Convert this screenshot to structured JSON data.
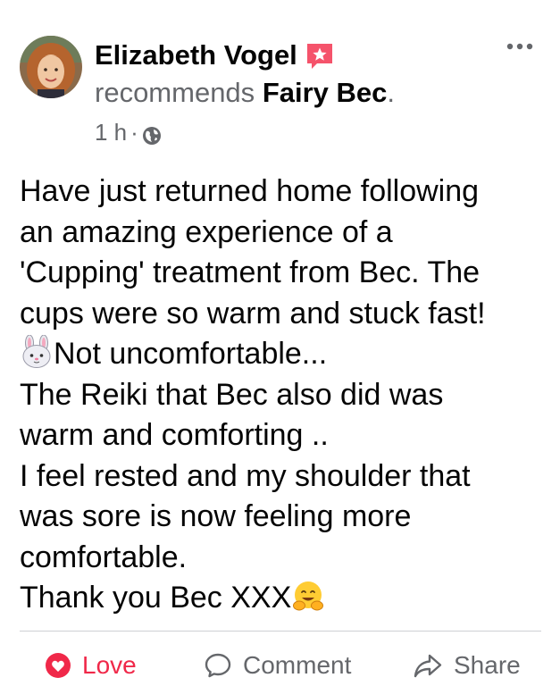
{
  "post": {
    "author_name": "Elizabeth Vogel",
    "recommend_verb": "recommends",
    "page_name": "Fairy Bec",
    "page_name_suffix": ".",
    "timestamp": "1 h",
    "meta_separator": "·",
    "audience_icon": "globe-icon",
    "body_lines": [
      "Have just returned home following",
      "an amazing experience of a",
      "'Cupping' treatment from Bec. The",
      "cups were so warm and stuck fast!",
      "Not uncomfortable...",
      "The Reiki that Bec also did was",
      "warm and comforting ..",
      "I feel rested and my shoulder that",
      "was sore is now feeling more",
      "comfortable.",
      "Thank you Bec XXX"
    ],
    "emojis": {
      "rabbit": "rabbit-face-emoji",
      "hug": "hugging-face-emoji"
    }
  },
  "actions": {
    "love_label": "Love",
    "comment_label": "Comment",
    "share_label": "Share"
  },
  "colors": {
    "love_red": "#f02849",
    "secondary_text": "#65676b",
    "badge_pink": "#f5536b"
  }
}
